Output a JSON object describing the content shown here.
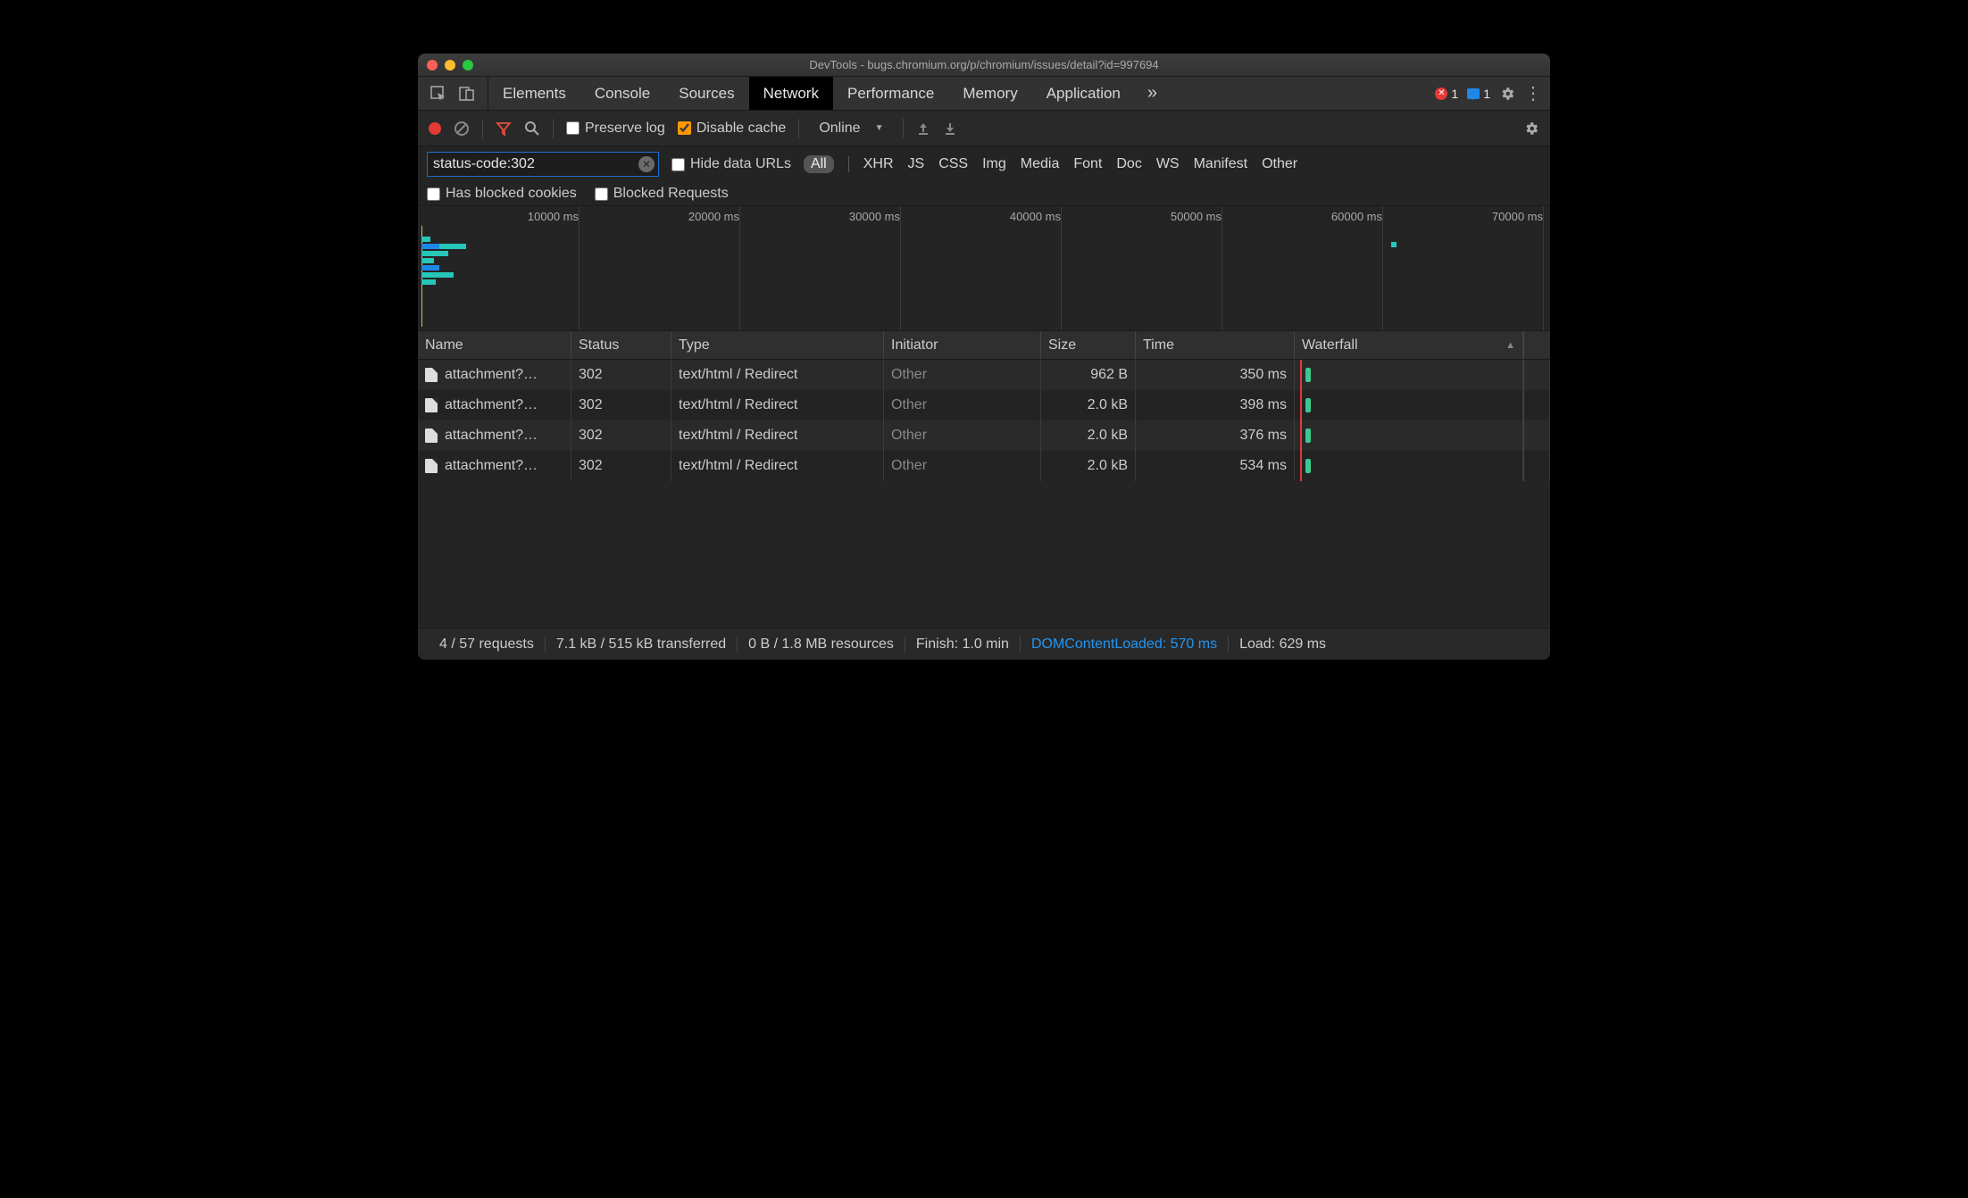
{
  "window": {
    "title": "DevTools - bugs.chromium.org/p/chromium/issues/detail?id=997694"
  },
  "main_tabs": {
    "items": [
      "Elements",
      "Console",
      "Sources",
      "Network",
      "Performance",
      "Memory",
      "Application"
    ],
    "active": "Network",
    "more_glyph": "»"
  },
  "header_badges": {
    "error_count": "1",
    "message_count": "1"
  },
  "toolbar": {
    "preserve_log_label": "Preserve log",
    "preserve_log_checked": false,
    "disable_cache_label": "Disable cache",
    "disable_cache_checked": true,
    "throttling_value": "Online"
  },
  "filter": {
    "input_value": "status-code:302",
    "hide_data_urls_label": "Hide data URLs",
    "hide_data_urls_checked": false,
    "types": [
      "All",
      "XHR",
      "JS",
      "CSS",
      "Img",
      "Media",
      "Font",
      "Doc",
      "WS",
      "Manifest",
      "Other"
    ],
    "types_active": "All",
    "has_blocked_cookies_label": "Has blocked cookies",
    "has_blocked_cookies_checked": false,
    "blocked_requests_label": "Blocked Requests",
    "blocked_requests_checked": false
  },
  "overview": {
    "tick_labels": [
      "10000 ms",
      "20000 ms",
      "30000 ms",
      "40000 ms",
      "50000 ms",
      "60000 ms",
      "70000 ms"
    ]
  },
  "table": {
    "columns": [
      "Name",
      "Status",
      "Type",
      "Initiator",
      "Size",
      "Time",
      "Waterfall"
    ],
    "sort_column": "Waterfall",
    "rows": [
      {
        "name": "attachment?…",
        "status": "302",
        "type": "text/html / Redirect",
        "initiator": "Other",
        "size": "962 B",
        "time": "350 ms"
      },
      {
        "name": "attachment?…",
        "status": "302",
        "type": "text/html / Redirect",
        "initiator": "Other",
        "size": "2.0 kB",
        "time": "398 ms"
      },
      {
        "name": "attachment?…",
        "status": "302",
        "type": "text/html / Redirect",
        "initiator": "Other",
        "size": "2.0 kB",
        "time": "376 ms"
      },
      {
        "name": "attachment?…",
        "status": "302",
        "type": "text/html / Redirect",
        "initiator": "Other",
        "size": "2.0 kB",
        "time": "534 ms"
      }
    ]
  },
  "statusbar": {
    "requests": "4 / 57 requests",
    "transferred": "7.1 kB / 515 kB transferred",
    "resources": "0 B / 1.8 MB resources",
    "finish": "Finish: 1.0 min",
    "dcl": "DOMContentLoaded: 570 ms",
    "load": "Load: 629 ms"
  }
}
